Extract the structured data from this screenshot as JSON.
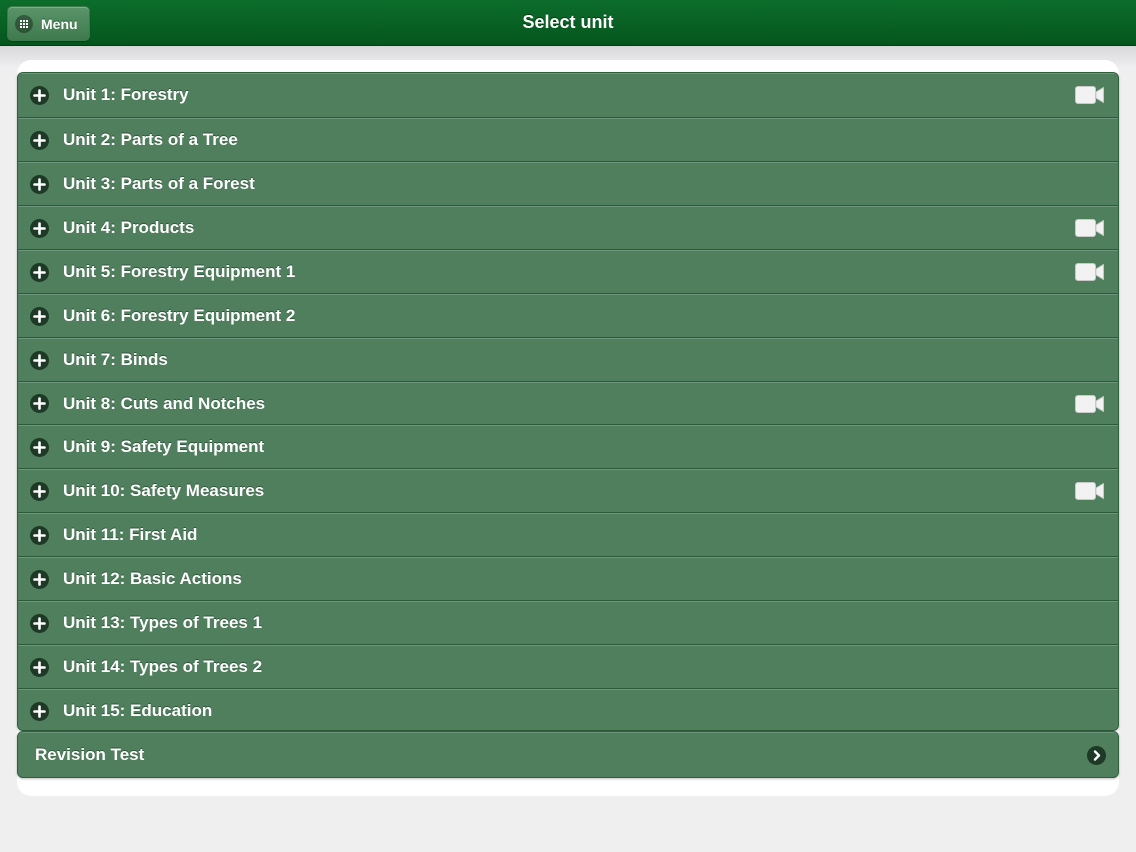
{
  "header": {
    "title": "Select unit",
    "menu_label": "Menu",
    "background_color": "#05561d"
  },
  "units": [
    {
      "label": "Unit 1: Forestry",
      "has_video": true
    },
    {
      "label": "Unit 2: Parts of a Tree",
      "has_video": false
    },
    {
      "label": "Unit 3: Parts of a Forest",
      "has_video": false
    },
    {
      "label": "Unit 4: Products",
      "has_video": true
    },
    {
      "label": "Unit 5: Forestry Equipment 1",
      "has_video": true
    },
    {
      "label": "Unit 6: Forestry Equipment 2",
      "has_video": false
    },
    {
      "label": "Unit 7: Binds",
      "has_video": false
    },
    {
      "label": "Unit 8: Cuts and Notches",
      "has_video": true
    },
    {
      "label": "Unit 9: Safety Equipment",
      "has_video": false
    },
    {
      "label": "Unit 10: Safety Measures",
      "has_video": true
    },
    {
      "label": "Unit 11: First Aid",
      "has_video": false
    },
    {
      "label": "Unit 12: Basic Actions",
      "has_video": false
    },
    {
      "label": "Unit 13: Types of Trees 1",
      "has_video": false
    },
    {
      "label": "Unit 14: Types of Trees 2",
      "has_video": false
    },
    {
      "label": "Unit 15: Education",
      "has_video": false
    }
  ],
  "revision": {
    "label": "Revision Test"
  },
  "icons": {
    "menu": "grid-icon",
    "expand": "plus-icon",
    "video": "video-camera-icon",
    "next": "chevron-right-icon"
  },
  "colors": {
    "row": "#4f7f5d",
    "icon_circle": "#1e3a27",
    "text": "#ffffff"
  }
}
